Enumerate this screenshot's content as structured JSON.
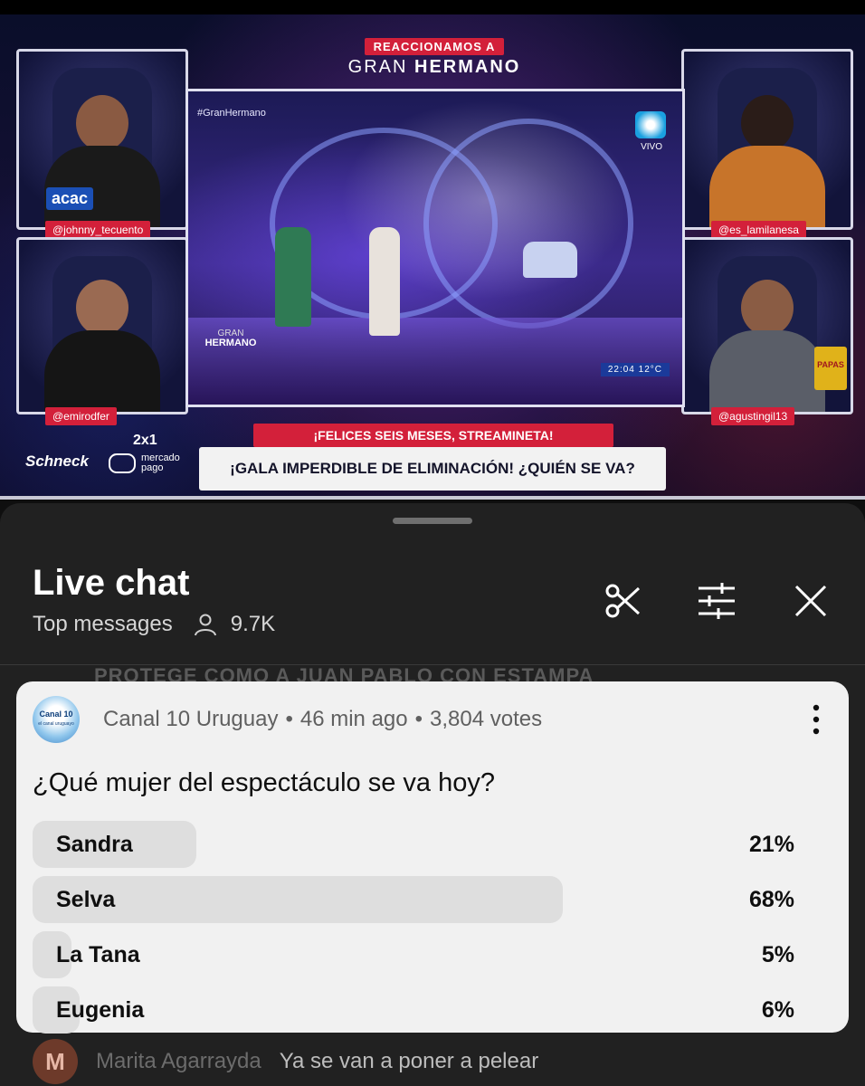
{
  "overlay": {
    "kicker": "REACCIONAMOS A",
    "show_title_a": "GRAN",
    "show_title_b": "HERMANO",
    "hosts": [
      "@johnny_tecuento",
      "@emirodfer",
      "@es_lamilanesa",
      "@agustingil13"
    ],
    "acac_badge": "acac",
    "hashtag": "#GranHermano",
    "vivo": "VIVO",
    "gh_logo_a": "GRAN",
    "gh_logo_b": "HERMANO",
    "clock": "22:04  12°C",
    "banner_top": "¡FELICES SEIS MESES, STREAMINETA!",
    "banner_main": "¡GALA IMPERDIBLE DE ELIMINACIÓN! ¿QUIÉN SE VA?",
    "sponsor_1": "Schneck",
    "sponsor_2": "2x1",
    "sponsor_3a": "mercado",
    "sponsor_3b": "pago",
    "chips": "PAPAS"
  },
  "chat": {
    "title": "Live chat",
    "mode": "Top messages",
    "viewers": "9.7K",
    "icons": [
      "scissors-icon",
      "tune-icon",
      "close-icon",
      "person-icon",
      "more-vert-icon"
    ],
    "ghost_top": "PROTEGE COMO A JUAN PABLO CON ESTAMPA",
    "ghost_avatar": "M",
    "ghost_name": "Marita Agarrayda",
    "ghost_text": "Ya se van a poner a pelear"
  },
  "poll": {
    "channel": "Canal 10 Uruguay",
    "channel_logo_a": "Canal 10",
    "channel_logo_b": "el canal uruguayo",
    "time": "46 min ago",
    "votes": "3,804 votes",
    "question": "¿Qué mujer del espectáculo se va hoy?",
    "options": [
      {
        "label": "Sandra",
        "percent": "21%",
        "fraction": 0.21
      },
      {
        "label": "Selva",
        "percent": "68%",
        "fraction": 0.68
      },
      {
        "label": "La Tana",
        "percent": "5%",
        "fraction": 0.05
      },
      {
        "label": "Eugenia",
        "percent": "6%",
        "fraction": 0.06
      }
    ]
  },
  "colors": {
    "accent_red": "#d3203a",
    "sheet_bg": "#212121",
    "card_bg": "#f1f1f1",
    "bar_fill": "#dedede"
  }
}
